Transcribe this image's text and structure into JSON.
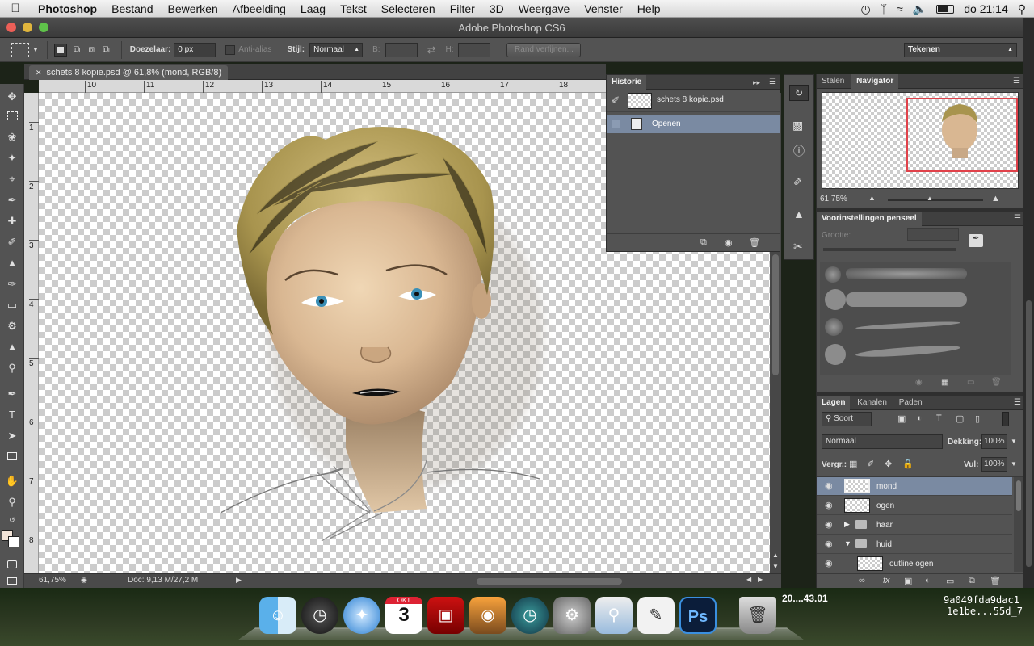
{
  "menubar": {
    "items": [
      "Photoshop",
      "Bestand",
      "Bewerken",
      "Afbeelding",
      "Laag",
      "Tekst",
      "Selecteren",
      "Filter",
      "3D",
      "Weergave",
      "Venster",
      "Help"
    ],
    "clock": "do 21:14",
    "icons": [
      "time-machine-icon",
      "bluetooth-icon",
      "wifi-icon",
      "volume-icon",
      "battery-icon",
      "spotlight-icon"
    ]
  },
  "window": {
    "title": "Adobe Photoshop CS6"
  },
  "options": {
    "feather_label": "Doezelaar:",
    "feather_value": "0 px",
    "antialias": "Anti-alias",
    "style_label": "Stijl:",
    "style_value": "Normaal",
    "w_label": "B:",
    "h_label": "H:",
    "refine": "Rand verfijnen...",
    "workspace": "Tekenen"
  },
  "document": {
    "tab": "schets 8 kopie.psd @ 61,8% (mond, RGB/8)",
    "zoom": "61,75%",
    "doc_info": "Doc: 9,13 M/27,2 M",
    "hruler": [
      "10",
      "11",
      "12",
      "13",
      "14",
      "15",
      "16",
      "17",
      "18"
    ],
    "vruler": [
      "1",
      "2",
      "3",
      "4",
      "5",
      "6",
      "7",
      "8"
    ]
  },
  "history": {
    "title": "Historie",
    "snapshot": "schets 8 kopie.psd",
    "items": [
      "Openen"
    ]
  },
  "navigator": {
    "tabs": [
      "Stalen",
      "Navigator"
    ],
    "zoom": "61,75%"
  },
  "brushes": {
    "title": "Voorinstellingen penseel",
    "size_label": "Grootte:"
  },
  "layers": {
    "tabs": [
      "Lagen",
      "Kanalen",
      "Paden"
    ],
    "filter": "Soort",
    "blend": "Normaal",
    "opacity_label": "Dekking:",
    "opacity": "100%",
    "lock_label": "Vergr.:",
    "fill_label": "Vul:",
    "fill": "100%",
    "rows": [
      {
        "name": "mond",
        "type": "layer",
        "selected": true
      },
      {
        "name": "ogen",
        "type": "layer",
        "selected": false
      },
      {
        "name": "haar",
        "type": "group",
        "selected": false
      },
      {
        "name": "huid",
        "type": "group-open",
        "selected": false
      },
      {
        "name": "outline ogen",
        "type": "layer",
        "selected": false
      }
    ]
  },
  "desktop": {
    "file1": "20....43.01",
    "file2": "9a049fda9dac1",
    "file3": "1e1be...55d_7"
  },
  "dock": {
    "calendar_month": "OKT",
    "calendar_day": "3",
    "ps": "Ps"
  }
}
